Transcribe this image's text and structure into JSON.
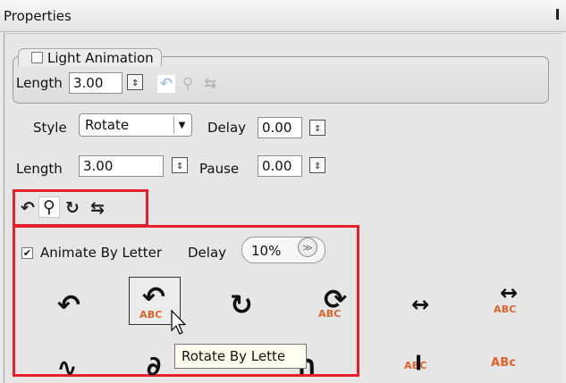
{
  "window": {
    "title": "Properties"
  },
  "light_animation": {
    "label": "Light Animation",
    "checked": false,
    "length_label": "Length",
    "length_value": "3.00"
  },
  "style_row": {
    "style_label": "Style",
    "style_value": "Rotate",
    "delay_label": "Delay",
    "delay_value": "0.00"
  },
  "length_row": {
    "length_label": "Length",
    "length_value": "3.00",
    "pause_label": "Pause",
    "pause_value": "0.00"
  },
  "icons": {
    "spinner_up": "up-down-spinner-icon",
    "rotate_left": "rotate-left-icon",
    "rotate_pin": "rotate-pin-icon",
    "rotate_circle": "rotate-circle-icon",
    "repeat": "repeat-icon",
    "dropdown_arrow": "chevron-down-icon",
    "double_chevron": "double-chevron-down-icon"
  },
  "animate_by_letter": {
    "label": "Animate By Letter",
    "checked": true,
    "delay_label": "Delay",
    "delay_value": "10%"
  },
  "effects": {
    "abc_label": "ABC",
    "abc_small_label": "ABc"
  },
  "tooltip": {
    "text": "Rotate By Lette"
  },
  "colors": {
    "highlight_box": "#e6212d",
    "abc_orange": "#e0622a"
  }
}
